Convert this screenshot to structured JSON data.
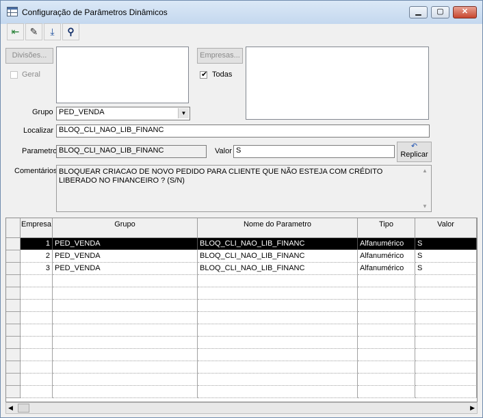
{
  "window": {
    "title": "Configuração de Parâmetros Dinâmicos",
    "minimize_icon": "minimize-icon",
    "maximize_icon": "maximize-icon",
    "close_icon": "close-icon"
  },
  "toolbar": {
    "buttons": [
      {
        "name": "exit-button",
        "icon": "exit-door-icon",
        "glyph": "⇤"
      },
      {
        "name": "edit-button",
        "icon": "pencil-icon",
        "glyph": "✎"
      },
      {
        "name": "save-button",
        "icon": "download-tray-icon",
        "glyph": "⤓"
      },
      {
        "name": "find-button",
        "icon": "binoculars-icon",
        "glyph": "⚲"
      }
    ]
  },
  "form": {
    "divisoes_button": "Divisões...",
    "geral_label": "Geral",
    "empresas_button": "Empresas...",
    "todas_label": "Todas",
    "todas_checked": true,
    "grupo_label": "Grupo",
    "grupo_value": "PED_VENDA",
    "localizar_label": "Localizar",
    "localizar_value": "BLOQ_CLI_NAO_LIB_FINANC",
    "parametro_label": "Parametro",
    "parametro_value": "BLOQ_CLI_NAO_LIB_FINANC",
    "valor_label": "Valor",
    "valor_value": "S",
    "replicar_button": "Replicar",
    "comentarios_label": "Comentários",
    "comentarios_value": "BLOQUEAR CRIACAO DE NOVO PEDIDO PARA CLIENTE QUE NÃO ESTEJA COM CRÉDITO LIBERADO NO FINANCEIRO ? (S/N)"
  },
  "grid": {
    "columns": [
      "Empresa",
      "Grupo",
      "Nome do Parametro",
      "Tipo",
      "Valor"
    ],
    "rows": [
      [
        "1",
        "PED_VENDA",
        "BLOQ_CLI_NAO_LIB_FINANC",
        "Alfanumérico",
        "S"
      ],
      [
        "2",
        "PED_VENDA",
        "BLOQ_CLI_NAO_LIB_FINANC",
        "Alfanumérico",
        "S"
      ],
      [
        "3",
        "PED_VENDA",
        "BLOQ_CLI_NAO_LIB_FINANC",
        "Alfanumérico",
        "S"
      ]
    ],
    "selected_row": 0
  }
}
